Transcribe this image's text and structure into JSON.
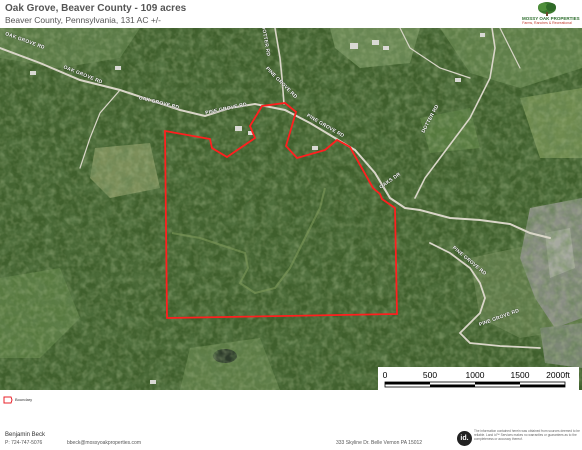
{
  "header": {
    "title": "Oak Grove, Beaver County - 109 acres",
    "subtitle": "Beaver County, Pennsylvania, 131 AC +/-"
  },
  "logo": {
    "brand": "MOSSY OAK PROPERTIES",
    "tagline": "Farms, Ranches & Recreational",
    "colors": {
      "green": "#2d6e2d",
      "red": "#c0392b"
    }
  },
  "map": {
    "road_labels": [
      "OAK GROVE RD",
      "OAK GROVE RD",
      "OAK GROVE RD",
      "PINE GROVE RD",
      "PINE GROVE RD",
      "PINE GROVE RD",
      "PINE GROVE RD",
      "PINE GROVE RD",
      "DOTTER RD",
      "OAKS DR",
      "DOTTER RD"
    ],
    "boundary_color": "#ff1f1f"
  },
  "scale_bar": {
    "ticks": [
      "0",
      "500",
      "1000",
      "1500",
      "2000ft"
    ]
  },
  "legend": {
    "label": "Boundary",
    "color": "#e8202a"
  },
  "footer": {
    "agent_name": "Benjamin Beck",
    "agent_phone": "P: 724-747-5076",
    "agent_email": "bbeck@mossyoakproperties.com",
    "agent_address": "333 Skyline Dr. Belle Vernon PA 15012",
    "id_logo": "id.",
    "disclaimer": "The information contained herein was obtained from sources deemed to be reliable. Land id™ Services makes no warranties or guarantees as to the completeness or accuracy thereof."
  }
}
